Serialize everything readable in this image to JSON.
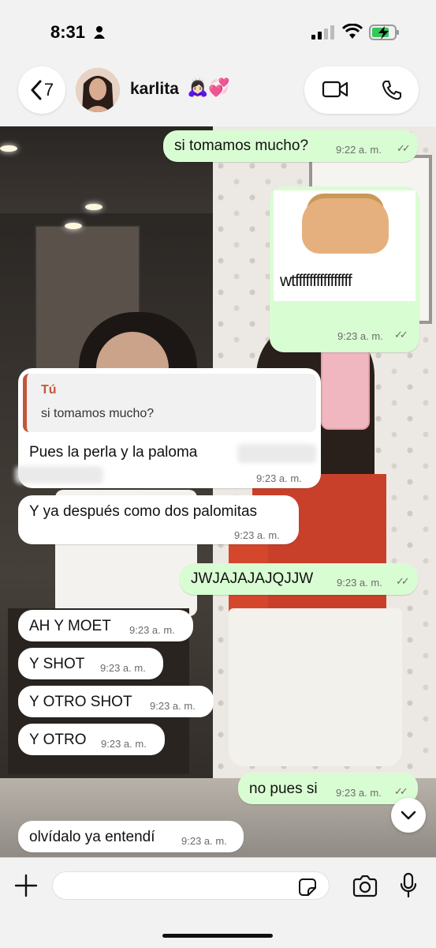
{
  "status_bar": {
    "time": "8:31",
    "person_icon": "person-icon",
    "signal_icon": "signal-icon",
    "wifi_icon": "wifi-icon",
    "battery_icon": "battery-charging-icon"
  },
  "header": {
    "back_count": "7",
    "contact_name": "karlita",
    "contact_emoji": "🙇🏻‍♀️💞",
    "icons": [
      "chevron-left-icon",
      "video-call-icon",
      "phone-call-icon"
    ]
  },
  "messages": [
    {
      "direction": "out",
      "text": "si tomamos mucho?",
      "time": "9:22 a. m.",
      "read": true
    },
    {
      "direction": "out",
      "type": "image",
      "caption": "wtffffffffffffffff",
      "time": "9:23 a. m.",
      "read": true
    },
    {
      "direction": "in",
      "reply_to": {
        "author": "Tú",
        "text": "si tomamos mucho?"
      },
      "text": "Pues la perla y la paloma",
      "time": "9:23 a. m."
    },
    {
      "direction": "in",
      "text": "Y ya después como dos palomitas",
      "time": "9:23 a. m."
    },
    {
      "direction": "out",
      "text": "JWJAJAJAJQJJW",
      "time": "9:23 a. m.",
      "read": true
    },
    {
      "direction": "in",
      "text": "AH Y MOET",
      "time": "9:23 a. m."
    },
    {
      "direction": "in",
      "text": "Y SHOT",
      "time": "9:23 a. m."
    },
    {
      "direction": "in",
      "text": "Y OTRO SHOT",
      "time": "9:23 a. m."
    },
    {
      "direction": "in",
      "text": "Y OTRO",
      "time": "9:23 a. m."
    },
    {
      "direction": "out",
      "text": "no pues si",
      "time": "9:23 a. m.",
      "read": true
    },
    {
      "direction": "in",
      "text": "olvídalo ya entendí",
      "time": "9:23 a. m."
    }
  ],
  "read_ticks": "✓✓",
  "input_bar": {
    "placeholder": "",
    "icons": [
      "plus-icon",
      "sticker-icon",
      "camera-icon",
      "microphone-icon"
    ]
  },
  "scroll_down_icon": "chevron-down-icon",
  "colors": {
    "outgoing_bubble": "#d9fdd3",
    "incoming_bubble": "#ffffff",
    "quote_accent": "#c0583a"
  }
}
